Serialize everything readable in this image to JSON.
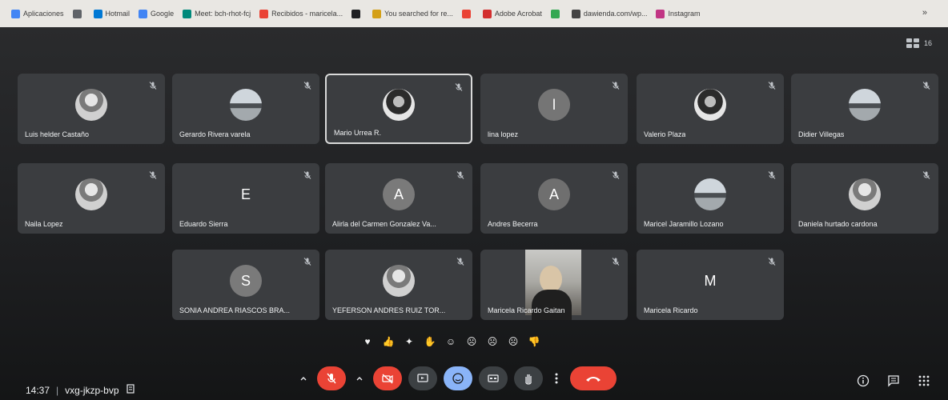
{
  "bookmarks": [
    {
      "label": "Aplicaciones",
      "color": "#4285f4"
    },
    {
      "label": "",
      "color": "#5f6368"
    },
    {
      "label": "Hotmail",
      "color": "#0078d4"
    },
    {
      "label": "Google",
      "color": "#4285f4"
    },
    {
      "label": "Meet: bch-rhot-fcj",
      "color": "#00897b"
    },
    {
      "label": "Recibidos - maricela...",
      "color": "#ea4335"
    },
    {
      "label": "",
      "color": "#202124"
    },
    {
      "label": "You searched for re...",
      "color": "#d4a017"
    },
    {
      "label": "",
      "color": "#ea4335"
    },
    {
      "label": "Adobe Acrobat",
      "color": "#d32f2f"
    },
    {
      "label": "",
      "color": "#34a853"
    },
    {
      "label": "dawienda.com/wp...",
      "color": "#444444"
    },
    {
      "label": "Instagram",
      "color": "#c13584"
    }
  ],
  "bookmarks_more": "»",
  "participant_count": "16",
  "participants": [
    {
      "name": "Luis helder Castaño",
      "avatar": "photo",
      "letter": "",
      "color": "#6b6b6b"
    },
    {
      "name": "Gerardo Rivera varela",
      "avatar": "photo3",
      "letter": "",
      "color": "#6b6b6b"
    },
    {
      "name": "Mario Urrea R.",
      "avatar": "photo2",
      "letter": "",
      "color": "#6b6b6b"
    },
    {
      "name": "lina lopez",
      "avatar": "letter",
      "letter": "l",
      "color": "#757575"
    },
    {
      "name": "Valerio Plaza",
      "avatar": "photo2",
      "letter": "",
      "color": "#6b6b6b"
    },
    {
      "name": "Didier Villegas",
      "avatar": "photo3",
      "letter": "",
      "color": "#6b6b6b"
    },
    {
      "name": "Naila Lopez",
      "avatar": "photo",
      "letter": "",
      "color": "#6b6b6b"
    },
    {
      "name": "Eduardo Sierra",
      "avatar": "letter",
      "letter": "E",
      "color": "transparent"
    },
    {
      "name": "Alirla del Carmen Gonzalez Va...",
      "avatar": "letter",
      "letter": "A",
      "color": "#7a7a7a"
    },
    {
      "name": "Andres Becerra",
      "avatar": "letter",
      "letter": "A",
      "color": "#6f6f6f"
    },
    {
      "name": "Maricel Jaramillo Lozano",
      "avatar": "photo3",
      "letter": "",
      "color": "#6b6b6b"
    },
    {
      "name": "Daniela hurtado cardona",
      "avatar": "photo",
      "letter": "",
      "color": "#6b6b6b"
    },
    {
      "name": "SONIA ANDREA RIASCOS BRA...",
      "avatar": "letter",
      "letter": "S",
      "color": "#7a7a7a"
    },
    {
      "name": "YEFERSON ANDRES RUIZ TOR...",
      "avatar": "photo",
      "letter": "",
      "color": "#6b6b6b"
    },
    {
      "name": "Maricela Ricardo Gaitan",
      "avatar": "video",
      "letter": "",
      "color": "#6b6b6b"
    },
    {
      "name": "Maricela Ricardo",
      "avatar": "letter",
      "letter": "M",
      "color": "transparent"
    }
  ],
  "reactions": [
    {
      "name": "heart",
      "glyph": "♥"
    },
    {
      "name": "thumbs-up",
      "glyph": "👍"
    },
    {
      "name": "party",
      "glyph": "✦"
    },
    {
      "name": "clap",
      "glyph": "✋"
    },
    {
      "name": "laugh",
      "glyph": "☺"
    },
    {
      "name": "surprised",
      "glyph": "☹"
    },
    {
      "name": "sad",
      "glyph": "☹"
    },
    {
      "name": "thinking",
      "glyph": "☹"
    },
    {
      "name": "thumbs-down",
      "glyph": "👎"
    }
  ],
  "meeting": {
    "time": "14:37",
    "separator": "|",
    "code": "vxg-jkzp-bvp"
  }
}
